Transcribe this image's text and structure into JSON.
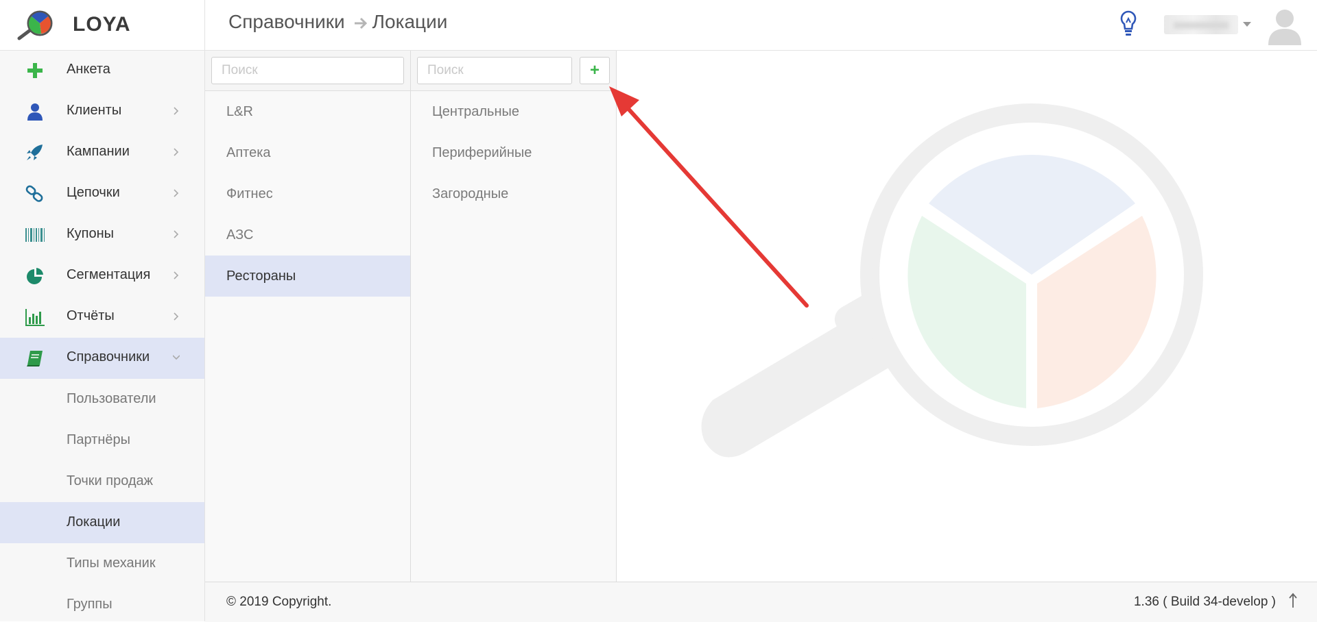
{
  "app": {
    "logo_text": "LOYA"
  },
  "header": {
    "breadcrumb_parent": "Справочники",
    "breadcrumb_current": "Локации"
  },
  "sidebar": {
    "items": [
      {
        "label": "Анкета",
        "icon": "plus-icon"
      },
      {
        "label": "Клиенты",
        "icon": "user-icon"
      },
      {
        "label": "Кампании",
        "icon": "rocket-icon"
      },
      {
        "label": "Цепочки",
        "icon": "chain-icon"
      },
      {
        "label": "Купоны",
        "icon": "barcode-icon"
      },
      {
        "label": "Сегментация",
        "icon": "pie-chart-icon"
      },
      {
        "label": "Отчёты",
        "icon": "bar-chart-icon"
      },
      {
        "label": "Справочники",
        "icon": "book-icon"
      }
    ],
    "sub_items": [
      {
        "label": "Пользователи"
      },
      {
        "label": "Партнёры"
      },
      {
        "label": "Точки продаж"
      },
      {
        "label": "Локации"
      },
      {
        "label": "Типы механик"
      },
      {
        "label": "Группы"
      }
    ],
    "active_item": "Справочники",
    "active_sub_item": "Локации"
  },
  "column1": {
    "search_placeholder": "Поиск",
    "items": [
      {
        "label": "L&R"
      },
      {
        "label": "Аптека"
      },
      {
        "label": "Фитнес"
      },
      {
        "label": "АЗС"
      },
      {
        "label": "Рестораны"
      }
    ],
    "selected": "Рестораны"
  },
  "column2": {
    "search_placeholder": "Поиск",
    "add_button_label": "+",
    "items": [
      {
        "label": "Центральные"
      },
      {
        "label": "Периферийные"
      },
      {
        "label": "Загородные"
      }
    ]
  },
  "footer": {
    "copyright": "© 2019 Copyright.",
    "version": "1.36 ( Build 34-develop )"
  },
  "colors": {
    "accent_green": "#3bb54a",
    "active_bg": "#dfe4f5",
    "icon_blue": "#2f57b8",
    "annotation_red": "#e53935"
  }
}
